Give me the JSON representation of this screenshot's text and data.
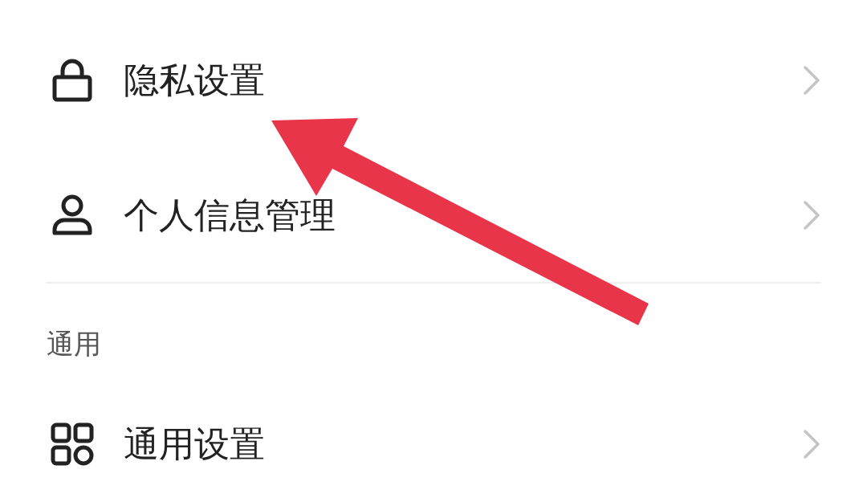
{
  "sections": [
    {
      "items": [
        {
          "label": "隐私设置",
          "kind": "lock"
        },
        {
          "label": "个人信息管理",
          "kind": "person"
        }
      ]
    },
    {
      "title": "通用",
      "items": [
        {
          "label": "通用设置",
          "kind": "grid"
        }
      ]
    }
  ]
}
